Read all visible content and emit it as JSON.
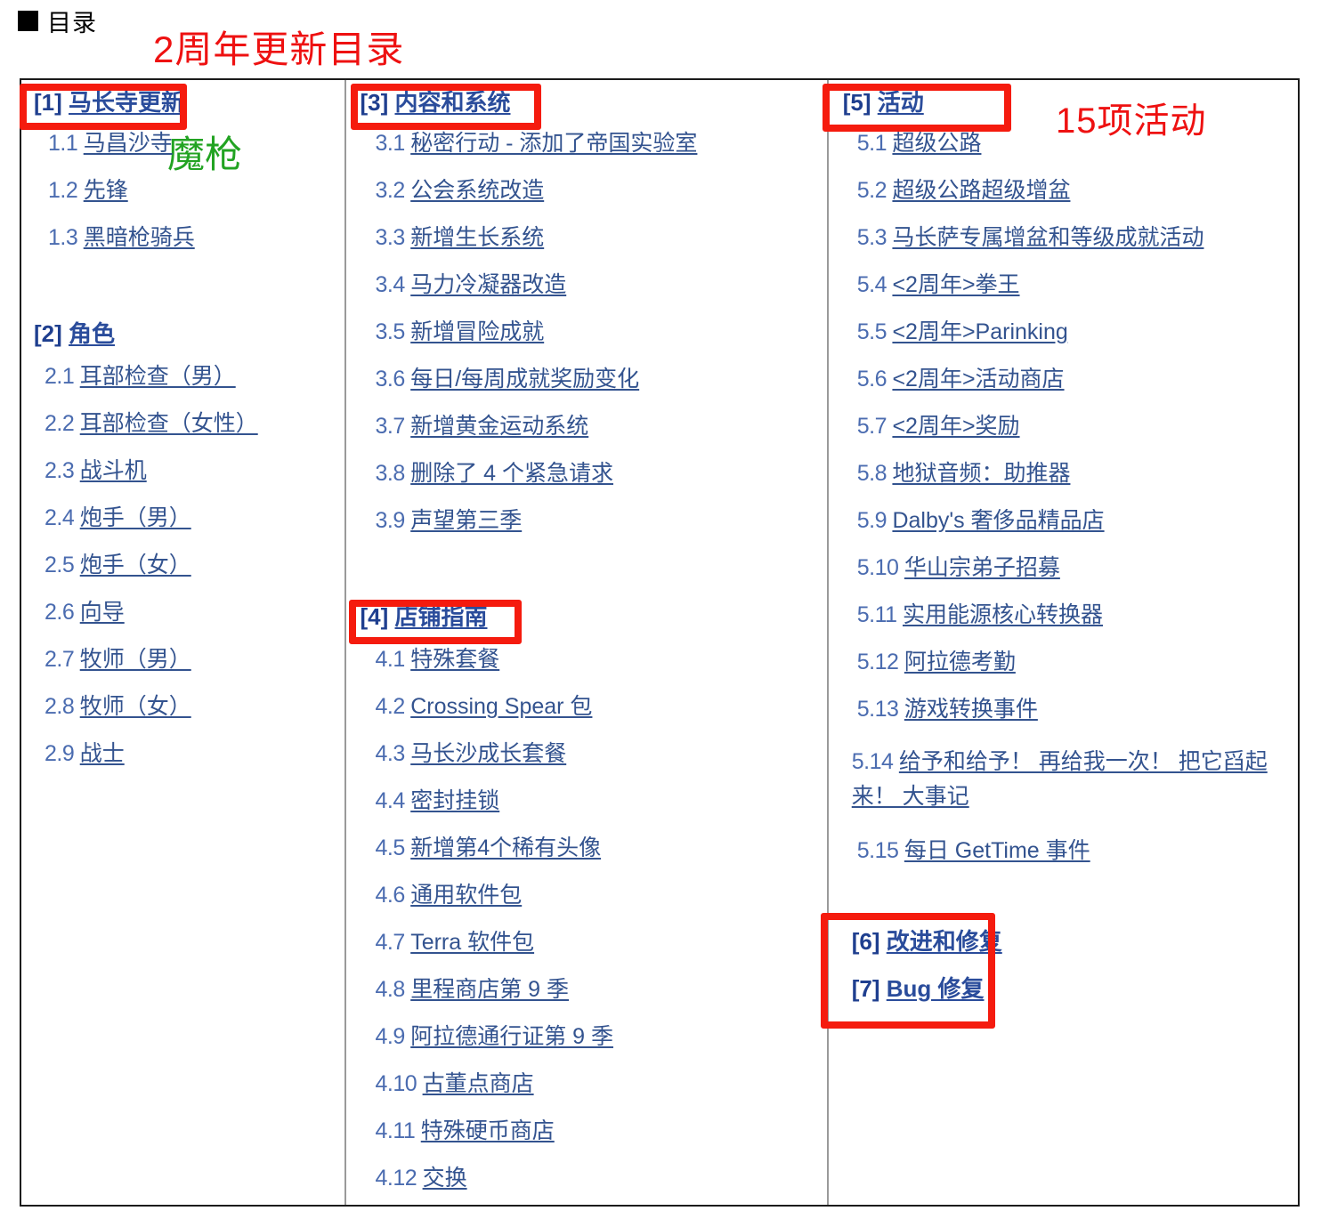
{
  "header": {
    "bullet_icon": "black-square-icon",
    "title": "目录"
  },
  "annotations": {
    "title_note": "2周年更新目录",
    "title_note_color": "#ee1111",
    "green_note": "魔枪",
    "green_note_color": "#22a322",
    "events_count_note": "15项活动",
    "highlight_color": "#f51b0e"
  },
  "columns": {
    "col1": {
      "sections": [
        {
          "id": "1",
          "number": "[1]",
          "title": "马长寺更新",
          "highlighted": true,
          "items": [
            {
              "num": "1.1",
              "label": "马昌沙寺"
            },
            {
              "num": "1.2",
              "label": "先锋"
            },
            {
              "num": "1.3",
              "label": "黑暗枪骑兵"
            }
          ]
        },
        {
          "id": "2",
          "number": "[2]",
          "title": "角色",
          "highlighted": false,
          "items": [
            {
              "num": "2.1",
              "label": "耳部检查（男）"
            },
            {
              "num": "2.2",
              "label": "耳部检查（女性）"
            },
            {
              "num": "2.3",
              "label": "战斗机"
            },
            {
              "num": "2.4",
              "label": "炮手（男）"
            },
            {
              "num": "2.5",
              "label": "炮手（女）"
            },
            {
              "num": "2.6",
              "label": "向导"
            },
            {
              "num": "2.7",
              "label": "牧师（男）"
            },
            {
              "num": "2.8",
              "label": "牧师（女）"
            },
            {
              "num": "2.9",
              "label": "战士"
            }
          ]
        }
      ]
    },
    "col2": {
      "sections": [
        {
          "id": "3",
          "number": "[3]",
          "title": "内容和系统",
          "highlighted": true,
          "items": [
            {
              "num": "3.1",
              "label": "秘密行动 - 添加了帝国实验室"
            },
            {
              "num": "3.2",
              "label": "公会系统改造"
            },
            {
              "num": "3.3",
              "label": "新增生长系统"
            },
            {
              "num": "3.4",
              "label": "马力冷凝器改造"
            },
            {
              "num": "3.5",
              "label": "新增冒险成就"
            },
            {
              "num": "3.6",
              "label": "每日/每周成就奖励变化"
            },
            {
              "num": "3.7",
              "label": "新增黄金运动系统"
            },
            {
              "num": "3.8",
              "label": "删除了 4 个紧急请求"
            },
            {
              "num": "3.9",
              "label": "声望第三季"
            }
          ]
        },
        {
          "id": "4",
          "number": "[4]",
          "title": "店铺指南",
          "highlighted": true,
          "items": [
            {
              "num": "4.1",
              "label": "特殊套餐"
            },
            {
              "num": "4.2",
              "label": "Crossing Spear 包"
            },
            {
              "num": "4.3",
              "label": "马长沙成长套餐"
            },
            {
              "num": "4.4",
              "label": "密封挂锁"
            },
            {
              "num": "4.5",
              "label": "新增第4个稀有头像"
            },
            {
              "num": "4.6",
              "label": "通用软件包"
            },
            {
              "num": "4.7",
              "label": "Terra 软件包"
            },
            {
              "num": "4.8",
              "label": "里程商店第 9 季"
            },
            {
              "num": "4.9",
              "label": "阿拉德通行证第 9 季"
            },
            {
              "num": "4.10",
              "label": "古董点商店"
            },
            {
              "num": "4.11",
              "label": "特殊硬币商店"
            },
            {
              "num": "4.12",
              "label": "交换"
            }
          ]
        }
      ]
    },
    "col3": {
      "sections": [
        {
          "id": "5",
          "number": "[5]",
          "title": "活动",
          "highlighted": true,
          "items": [
            {
              "num": "5.1",
              "label": "超级公路"
            },
            {
              "num": "5.2",
              "label": "超级公路超级增盆"
            },
            {
              "num": "5.3",
              "label": "马长萨专属增盆和等级成就活动"
            },
            {
              "num": "5.4",
              "label": "<2周年>拳王"
            },
            {
              "num": "5.5",
              "label": "<2周年>Parinking"
            },
            {
              "num": "5.6",
              "label": "<2周年>活动商店"
            },
            {
              "num": "5.7",
              "label": "<2周年>奖励"
            },
            {
              "num": "5.8",
              "label": "地狱音频：助推器"
            },
            {
              "num": "5.9",
              "label": "Dalby's 奢侈品精品店"
            },
            {
              "num": "5.10",
              "label": "华山宗弟子招募"
            },
            {
              "num": "5.11",
              "label": "实用能源核心转换器"
            },
            {
              "num": "5.12",
              "label": "阿拉德考勤"
            },
            {
              "num": "5.13",
              "label": "游戏转换事件"
            },
            {
              "num": "5.14",
              "label": "给予和给予！ 再给我一次！ 把它舀起来！ 大事记"
            },
            {
              "num": "5.15",
              "label": "每日 GetTime 事件"
            }
          ]
        },
        {
          "id": "6",
          "number": "[6]",
          "title": "改进和修复",
          "highlighted": true,
          "items": []
        },
        {
          "id": "7",
          "number": "[7]",
          "title": "Bug 修复",
          "highlighted": true,
          "items": []
        }
      ]
    }
  }
}
